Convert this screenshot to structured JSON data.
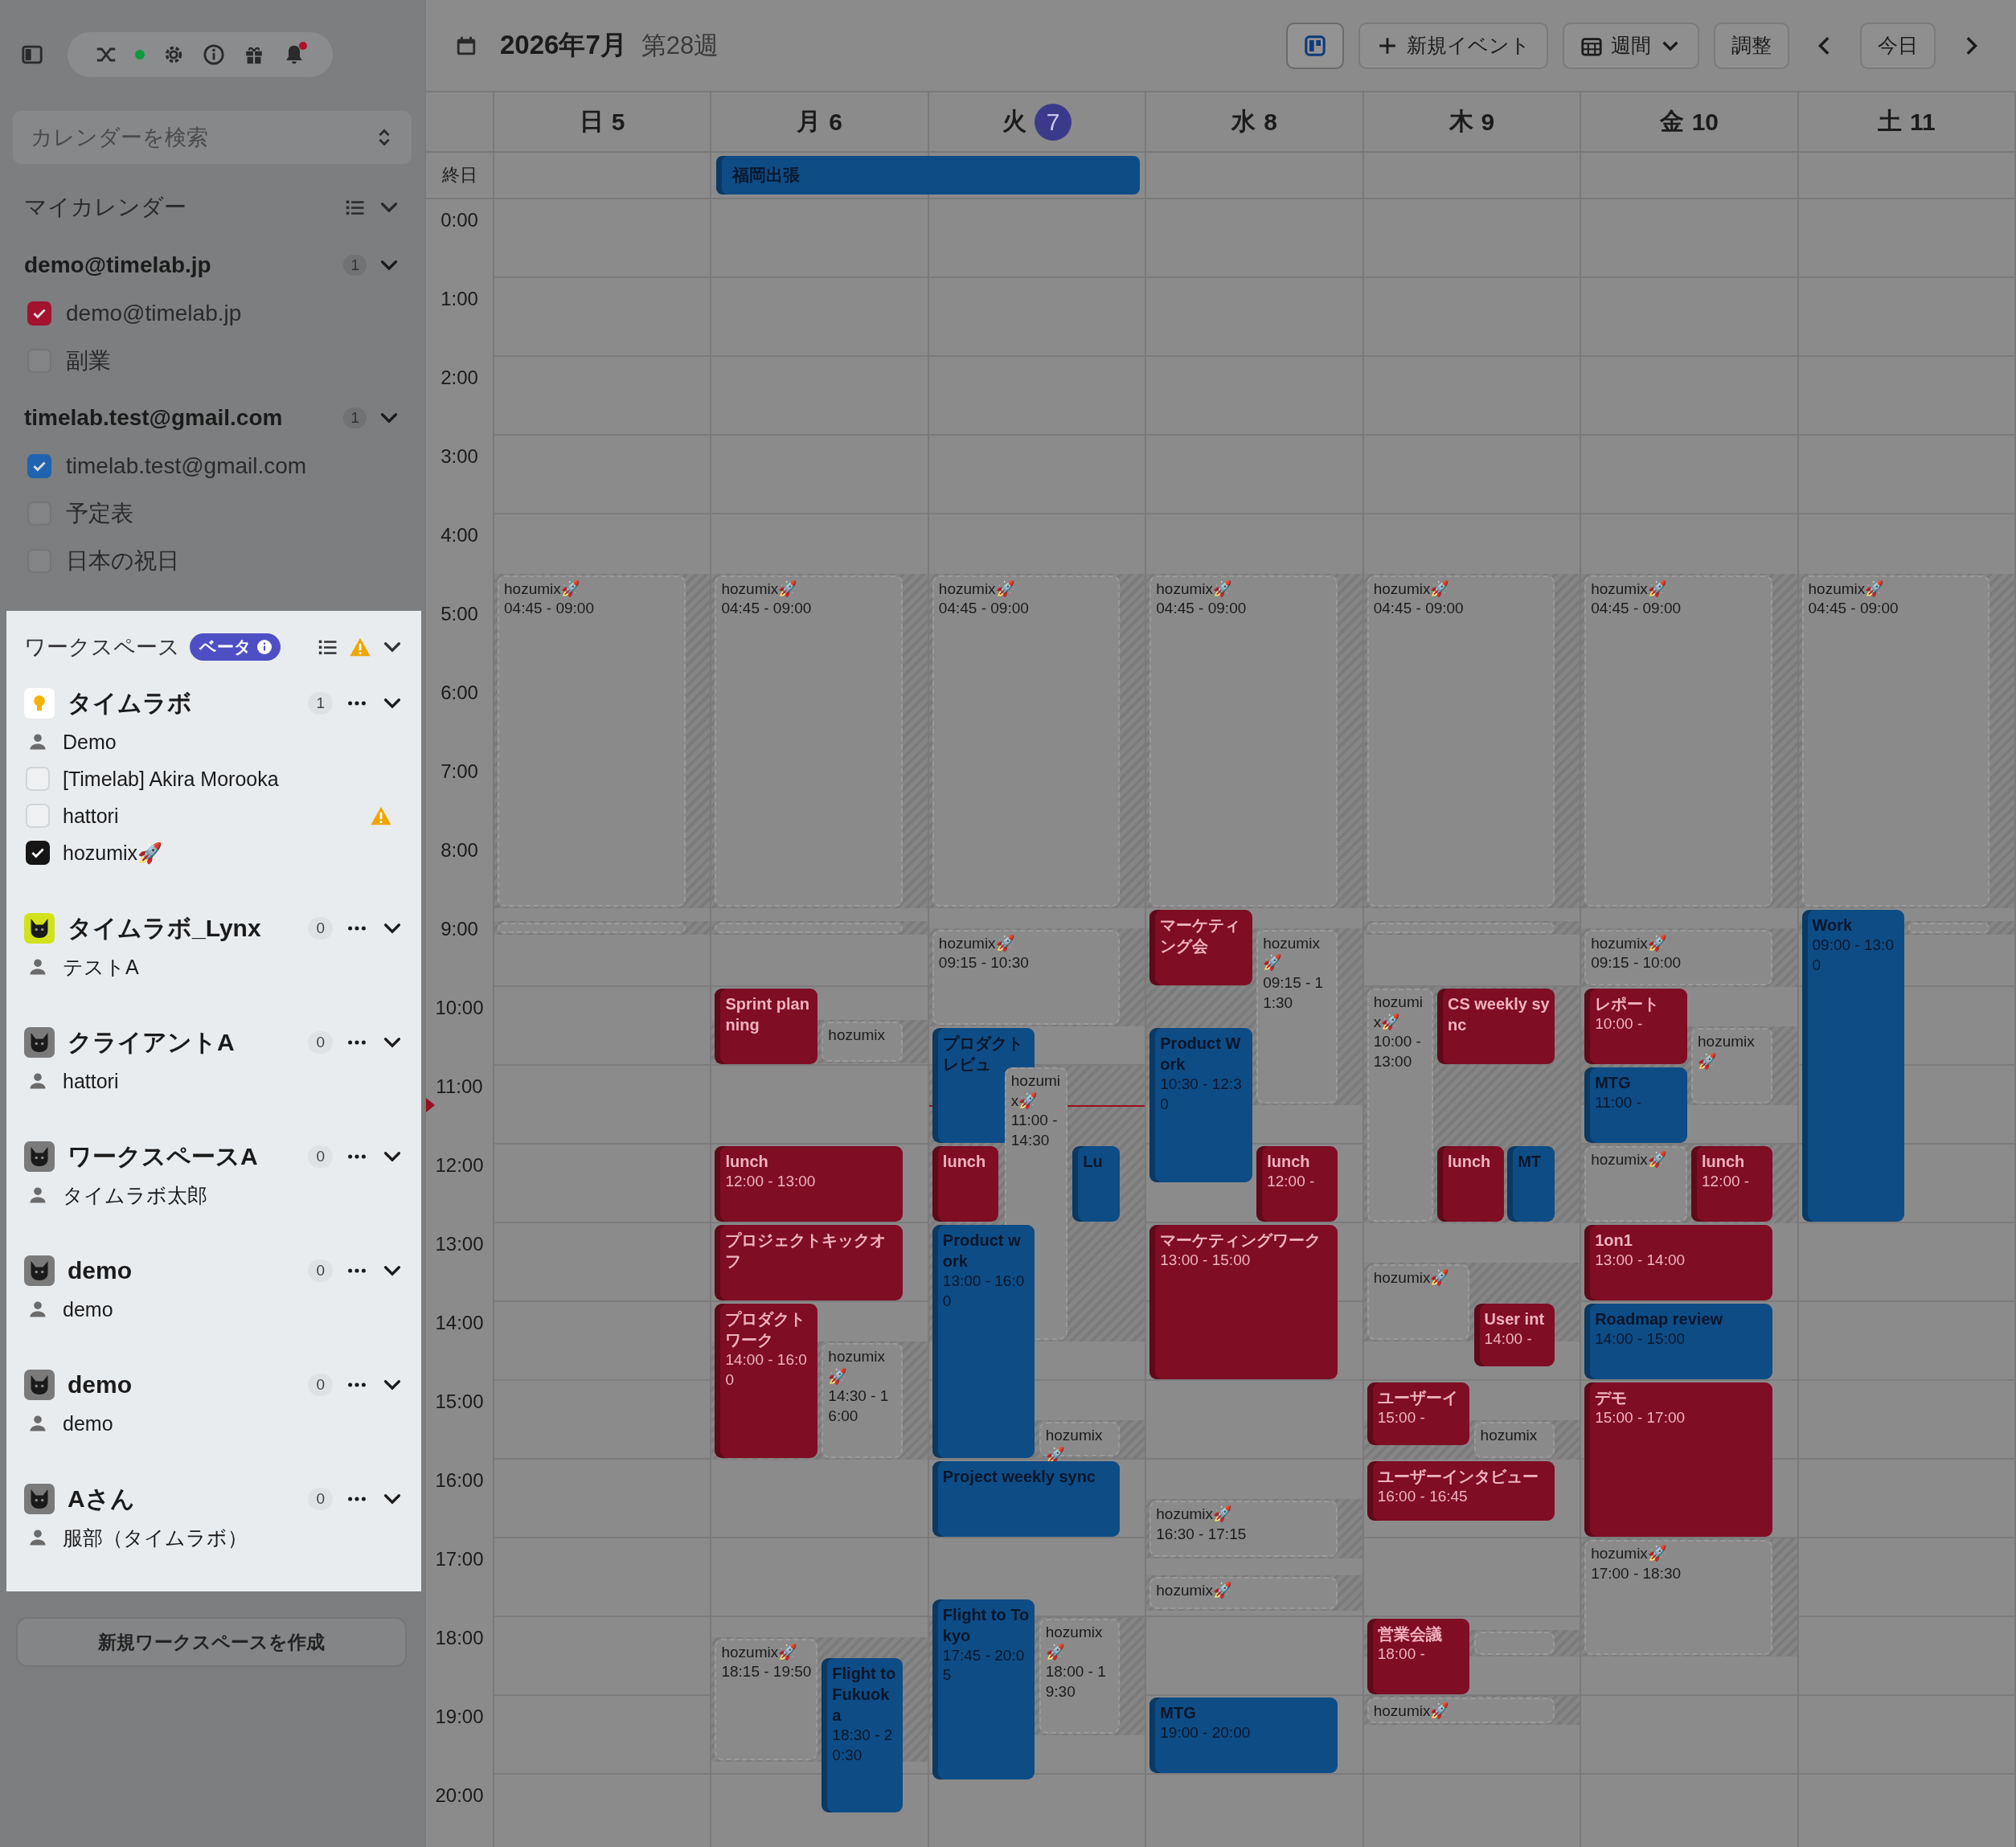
{
  "sidebar": {
    "status_online": true,
    "notifications": true,
    "search": {
      "placeholder": "カレンダーを検索"
    },
    "my_calendars": {
      "title": "マイカレンダー",
      "accounts": [
        {
          "account": "demo@timelab.jp",
          "count": "1",
          "calendars": [
            {
              "label": "demo@timelab.jp",
              "checked": true,
              "color": "#a3122f"
            },
            {
              "label": "副業",
              "checked": false
            }
          ]
        },
        {
          "account": "timelab.test@gmail.com",
          "count": "1",
          "calendars": [
            {
              "label": "timelab.test@gmail.com",
              "checked": true,
              "color": "#2063b0"
            },
            {
              "label": "予定表",
              "checked": false
            },
            {
              "label": "日本の祝日",
              "checked": false
            }
          ]
        }
      ]
    },
    "workspaces": {
      "title": "ワークスペース",
      "badge": "ベータ",
      "warning": true,
      "items": [
        {
          "name": "タイムラボ",
          "kind": "bulb",
          "color": "#ffffff",
          "count": "1",
          "members": [
            {
              "kind": "person",
              "name": "Demo",
              "warning": false
            },
            {
              "kind": "checkbox",
              "name": "[Timelab] Akira Morooka",
              "checked": false,
              "warning": false
            },
            {
              "kind": "checkbox",
              "name": "hattori",
              "checked": false,
              "warning": true
            },
            {
              "kind": "checkbox",
              "name": "hozumix🚀",
              "checked": true,
              "warning": false
            }
          ]
        },
        {
          "name": "タイムラボ_Lynx",
          "kind": "lynx",
          "color": "#d2e21a",
          "count": "0",
          "members": [
            {
              "kind": "person",
              "name": "テストA",
              "warning": false
            }
          ]
        },
        {
          "name": "クライアントA",
          "kind": "lynx",
          "color": "#7a7a7a",
          "count": "0",
          "members": [
            {
              "kind": "person",
              "name": "hattori",
              "warning": false
            }
          ]
        },
        {
          "name": "ワークスペースA",
          "kind": "lynx",
          "color": "#7a7a7a",
          "count": "0",
          "members": [
            {
              "kind": "person",
              "name": "タイムラボ太郎",
              "warning": false
            }
          ]
        },
        {
          "name": "demo",
          "kind": "lynx",
          "color": "#7a7a7a",
          "count": "0",
          "members": [
            {
              "kind": "person",
              "name": "demo",
              "warning": false
            }
          ]
        },
        {
          "name": "demo",
          "kind": "lynx",
          "color": "#7a7a7a",
          "count": "0",
          "members": [
            {
              "kind": "person",
              "name": "demo",
              "warning": false
            }
          ]
        },
        {
          "name": "Aさん",
          "kind": "lynx",
          "color": "#7a7a7a",
          "count": "0",
          "members": [
            {
              "kind": "person",
              "name": "服部（タイムラボ）",
              "warning": false
            }
          ]
        }
      ]
    },
    "create_button": "新規ワークスペースを作成"
  },
  "toolbar": {
    "title": "2026年7月",
    "week": "第28週",
    "layout_toggle": {
      "selected": true
    },
    "new_event": "新規イベント",
    "view": "週間",
    "adjust": "調整",
    "today": "今日"
  },
  "calendar": {
    "all_day_label": "終日",
    "hours": [
      "0:00",
      "1:00",
      "2:00",
      "3:00",
      "4:00",
      "5:00",
      "6:00",
      "7:00",
      "8:00",
      "9:00",
      "10:00",
      "11:00",
      "12:00",
      "13:00",
      "14:00",
      "15:00",
      "16:00",
      "17:00",
      "18:00",
      "19:00",
      "20:00"
    ],
    "days": [
      {
        "dow": "日",
        "date": "5",
        "today": false,
        "events": [
          {
            "kind": "busy",
            "title": "hozumix🚀",
            "time": "04:45 - 09:00"
          },
          {
            "kind": "busy"
          }
        ]
      },
      {
        "dow": "月",
        "date": "6",
        "today": false,
        "all_day": {
          "title": "福岡出張",
          "continues": true
        },
        "events": [
          {
            "kind": "busy",
            "title": "hozumix🚀",
            "time": "04:45 - 09:00"
          },
          {
            "kind": "busy"
          },
          {
            "kind": "event",
            "title": "Sprint planning",
            "color": "#7f0d24"
          },
          {
            "kind": "busy",
            "title": "hozumix"
          },
          {
            "kind": "event",
            "title": "lunch",
            "time": "12:00 - 13:00",
            "color": "#7f0d24"
          },
          {
            "kind": "event",
            "title": "プロジェクトキックオフ",
            "color": "#7f0d24"
          },
          {
            "kind": "event",
            "title": "プロダクトワーク",
            "time": "14:00 - 16:00",
            "color": "#7f0d24"
          },
          {
            "kind": "busy",
            "title": "hozumix🚀",
            "time": "14:30 - 16:00"
          },
          {
            "kind": "busy",
            "title": "hozumix🚀",
            "time": "18:15 - 19:50"
          },
          {
            "kind": "event",
            "title": "Flight to Fukuoka",
            "time": "18:30 - 20:30",
            "color": "#0e4c86"
          }
        ]
      },
      {
        "dow": "火",
        "date": "7",
        "today": true,
        "events": [
          {
            "kind": "busy",
            "title": "hozumix🚀",
            "time": "04:45 - 09:00"
          },
          {
            "kind": "busy",
            "title": "hozumix🚀",
            "time": "09:15 - 10:30"
          },
          {
            "kind": "event",
            "title": "プロダクトレビュ",
            "color": "#0e4c86"
          },
          {
            "kind": "busy",
            "title": "hozumix🚀",
            "time": "11:00 - 14:30"
          },
          {
            "kind": "event",
            "title": "lunch",
            "color": "#7f0d24"
          },
          {
            "kind": "event",
            "title": "Lu",
            "color": "#0e4c86"
          },
          {
            "kind": "event",
            "title": "Product work",
            "time": "13:00 - 16:00",
            "color": "#0e4c86"
          },
          {
            "kind": "busy",
            "title": "hozumix🚀"
          },
          {
            "kind": "event",
            "title": "Project weekly sync",
            "color": "#0e4c86"
          },
          {
            "kind": "event",
            "title": "Flight to Tokyo",
            "time": "17:45 - 20:05",
            "color": "#0e4c86"
          },
          {
            "kind": "busy",
            "title": "hozumix🚀",
            "time": "18:00 - 19:30"
          }
        ]
      },
      {
        "dow": "水",
        "date": "8",
        "today": false,
        "events": [
          {
            "kind": "busy",
            "title": "hozumix🚀",
            "time": "04:45 - 09:00"
          },
          {
            "kind": "event",
            "title": "マーケティング会",
            "color": "#7f0d24"
          },
          {
            "kind": "busy",
            "title": "hozumix🚀",
            "time": "09:15 - 11:30"
          },
          {
            "kind": "event",
            "title": "Product Work",
            "time": "10:30 - 12:30",
            "color": "#0e4c86"
          },
          {
            "kind": "event",
            "title": "lunch",
            "time": "12:00 -",
            "color": "#7f0d24"
          },
          {
            "kind": "event",
            "title": "マーケティングワーク",
            "time": "13:00 - 15:00",
            "color": "#7f0d24"
          },
          {
            "kind": "busy",
            "title": "hozumix🚀",
            "time": "16:30 - 17:15"
          },
          {
            "kind": "busy",
            "title": "hozumix🚀"
          },
          {
            "kind": "event",
            "title": "MTG",
            "time": "19:00 - 20:00",
            "color": "#0e4c86"
          }
        ]
      },
      {
        "dow": "木",
        "date": "9",
        "today": false,
        "events": [
          {
            "kind": "busy",
            "title": "hozumix🚀",
            "time": "04:45 - 09:00"
          },
          {
            "kind": "busy"
          },
          {
            "kind": "busy",
            "title": "hozumix🚀",
            "time": "10:00 - 13:00"
          },
          {
            "kind": "event",
            "title": "CS weekly sync",
            "color": "#7f0d24"
          },
          {
            "kind": "event",
            "title": "lunch",
            "color": "#7f0d24"
          },
          {
            "kind": "event",
            "title": "MT",
            "color": "#0e4c86"
          },
          {
            "kind": "busy",
            "title": "hozumix🚀"
          },
          {
            "kind": "event",
            "title": "User int",
            "time": "14:00 -",
            "color": "#7f0d24"
          },
          {
            "kind": "event",
            "title": "ユーザーイ",
            "time": "15:00 -",
            "color": "#7f0d24"
          },
          {
            "kind": "busy",
            "title": "hozumix"
          },
          {
            "kind": "event",
            "title": "ユーザーインタビュー",
            "time": "16:00 - 16:45",
            "color": "#7f0d24"
          },
          {
            "kind": "event",
            "title": "営業会議",
            "time": "18:00 -",
            "color": "#7f0d24"
          },
          {
            "kind": "busy"
          },
          {
            "kind": "busy",
            "title": "hozumix🚀"
          }
        ]
      },
      {
        "dow": "金",
        "date": "10",
        "today": false,
        "events": [
          {
            "kind": "busy",
            "title": "hozumix🚀",
            "time": "04:45 - 09:00"
          },
          {
            "kind": "busy",
            "title": "hozumix🚀",
            "time": "09:15 - 10:00"
          },
          {
            "kind": "event",
            "title": "レポート",
            "time": "10:00 -",
            "color": "#7f0d24"
          },
          {
            "kind": "busy",
            "title": "hozumix🚀"
          },
          {
            "kind": "event",
            "title": "MTG",
            "time": "11:00 -",
            "color": "#0e4c86"
          },
          {
            "kind": "busy",
            "title": "hozumix🚀"
          },
          {
            "kind": "event",
            "title": "lunch",
            "time": "12:00 -",
            "color": "#7f0d24"
          },
          {
            "kind": "event",
            "title": "1on1",
            "time": "13:00 - 14:00",
            "color": "#7f0d24"
          },
          {
            "kind": "event",
            "title": "Roadmap review",
            "time": "14:00 - 15:00",
            "color": "#0e4c86"
          },
          {
            "kind": "event",
            "title": "デモ",
            "time": "15:00 - 17:00",
            "color": "#7f0d24"
          },
          {
            "kind": "busy",
            "title": "hozumix🚀",
            "time": "17:00 - 18:30"
          }
        ]
      },
      {
        "dow": "土",
        "date": "11",
        "today": false,
        "events": [
          {
            "kind": "busy",
            "title": "hozumix🚀",
            "time": "04:45 - 09:00"
          },
          {
            "kind": "event",
            "title": "Work",
            "time": "09:00 - 13:00",
            "color": "#0e4c86"
          },
          {
            "kind": "busy"
          }
        ]
      }
    ]
  }
}
